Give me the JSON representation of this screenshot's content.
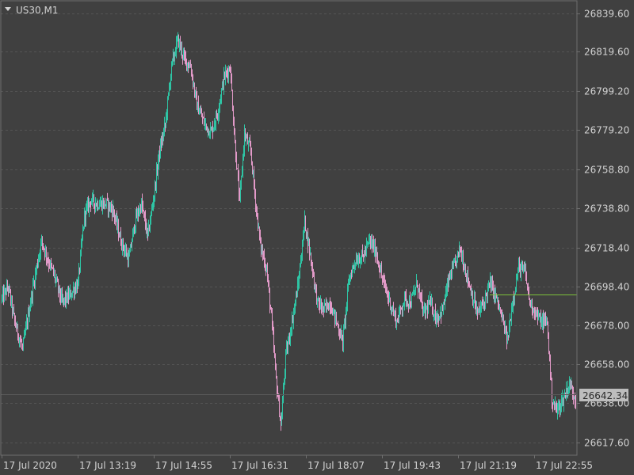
{
  "window": {
    "symbol_label": "US30,M1",
    "current_price_label": "26642.34"
  },
  "colors": {
    "background": "#404040",
    "grid": "#545454",
    "frame": "#6e6e6e",
    "bull_candle": "#2ec4a4",
    "bear_candle": "#e29ac8",
    "text": "#d2d2d2",
    "ask_line": "#7cbf3a",
    "bid_line": "#5a5a5a",
    "price_tag_bg": "#bdbdbd",
    "price_tag_text": "#2b2b2b"
  },
  "chart_data": {
    "type": "candlestick",
    "symbol": "US30",
    "timeframe": "M1",
    "y_ticks": [
      26839.6,
      26819.6,
      26799.2,
      26779.2,
      26758.8,
      26738.8,
      26718.4,
      26698.4,
      26678.0,
      26658.0,
      26638.0,
      26617.6
    ],
    "y_tick_labels": [
      "26839.60",
      "26819.60",
      "26799.20",
      "26779.20",
      "26758.80",
      "26738.80",
      "26718.40",
      "26698.40",
      "26678.00",
      "26658.00",
      "26638.00",
      "26617.60"
    ],
    "x_tick_labels": [
      "17 Jul 2020",
      "17 Jul 13:19",
      "17 Jul 14:55",
      "17 Jul 16:31",
      "17 Jul 18:07",
      "17 Jul 19:43",
      "17 Jul 21:19",
      "17 Jul 22:55"
    ],
    "ylim": [
      26611,
      26846
    ],
    "ask_level": 26694.3,
    "bid_level": 26642.34,
    "anchors": [
      [
        0,
        26692
      ],
      [
        8,
        26698
      ],
      [
        16,
        26680
      ],
      [
        26,
        26666
      ],
      [
        40,
        26700
      ],
      [
        50,
        26722
      ],
      [
        58,
        26712
      ],
      [
        66,
        26704
      ],
      [
        76,
        26690
      ],
      [
        86,
        26694
      ],
      [
        96,
        26700
      ],
      [
        104,
        26735
      ],
      [
        112,
        26743
      ],
      [
        120,
        26741
      ],
      [
        132,
        26741
      ],
      [
        140,
        26738
      ],
      [
        150,
        26722
      ],
      [
        160,
        26712
      ],
      [
        168,
        26732
      ],
      [
        176,
        26741
      ],
      [
        184,
        26724
      ],
      [
        192,
        26746
      ],
      [
        198,
        26766
      ],
      [
        206,
        26782
      ],
      [
        214,
        26812
      ],
      [
        222,
        26826
      ],
      [
        230,
        26816
      ],
      [
        238,
        26812
      ],
      [
        246,
        26792
      ],
      [
        256,
        26782
      ],
      [
        264,
        26778
      ],
      [
        272,
        26788
      ],
      [
        280,
        26806
      ],
      [
        288,
        26812
      ],
      [
        294,
        26772
      ],
      [
        300,
        26742
      ],
      [
        306,
        26777
      ],
      [
        314,
        26768
      ],
      [
        320,
        26742
      ],
      [
        326,
        26720
      ],
      [
        334,
        26707
      ],
      [
        340,
        26682
      ],
      [
        346,
        26650
      ],
      [
        352,
        26626
      ],
      [
        358,
        26662
      ],
      [
        366,
        26680
      ],
      [
        374,
        26700
      ],
      [
        382,
        26732
      ],
      [
        390,
        26712
      ],
      [
        398,
        26690
      ],
      [
        406,
        26686
      ],
      [
        414,
        26690
      ],
      [
        422,
        26680
      ],
      [
        430,
        26670
      ],
      [
        438,
        26702
      ],
      [
        446,
        26712
      ],
      [
        456,
        26714
      ],
      [
        464,
        26722
      ],
      [
        472,
        26716
      ],
      [
        480,
        26702
      ],
      [
        488,
        26692
      ],
      [
        498,
        26680
      ],
      [
        508,
        26692
      ],
      [
        516,
        26690
      ],
      [
        524,
        26700
      ],
      [
        532,
        26684
      ],
      [
        540,
        26690
      ],
      [
        548,
        26682
      ],
      [
        556,
        26686
      ],
      [
        564,
        26702
      ],
      [
        572,
        26710
      ],
      [
        578,
        26718
      ],
      [
        584,
        26708
      ],
      [
        592,
        26696
      ],
      [
        600,
        26684
      ],
      [
        608,
        26690
      ],
      [
        616,
        26700
      ],
      [
        624,
        26692
      ],
      [
        632,
        26680
      ],
      [
        638,
        26670
      ],
      [
        644,
        26690
      ],
      [
        652,
        26708
      ],
      [
        660,
        26706
      ],
      [
        666,
        26690
      ],
      [
        672,
        26686
      ],
      [
        680,
        26680
      ],
      [
        688,
        26680
      ],
      [
        694,
        26640
      ],
      [
        700,
        26634
      ],
      [
        708,
        26640
      ],
      [
        716,
        26648
      ],
      [
        724,
        26640
      ]
    ]
  }
}
